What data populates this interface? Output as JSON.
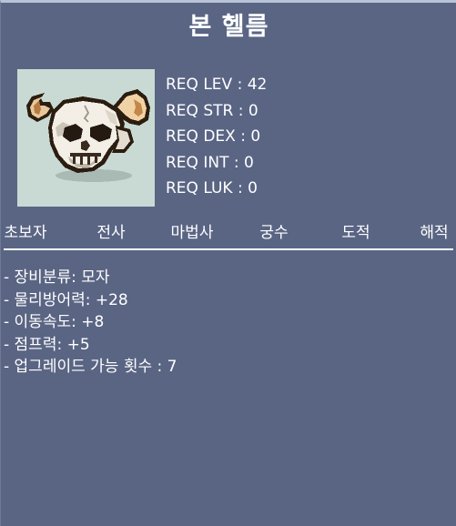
{
  "item": {
    "name": "본 헬름",
    "icon": "bone-helm-skull-icon"
  },
  "requirements": [
    "REQ LEV : 42",
    "REQ STR : 0",
    "REQ DEX : 0",
    "REQ INT : 0",
    "REQ LUK : 0"
  ],
  "jobs": [
    "초보자",
    "전사",
    "마법사",
    "궁수",
    "도적",
    "해적"
  ],
  "stats": [
    "- 장비분류: 모자",
    "- 물리방어력: +28",
    "- 이동속도: +8",
    "- 점프력: +5",
    "- 업그레이드 가능 횟수 : 7"
  ],
  "colors": {
    "background": "#5a6584",
    "icon_frame": "#c9dad4",
    "text": "#ffffff"
  }
}
